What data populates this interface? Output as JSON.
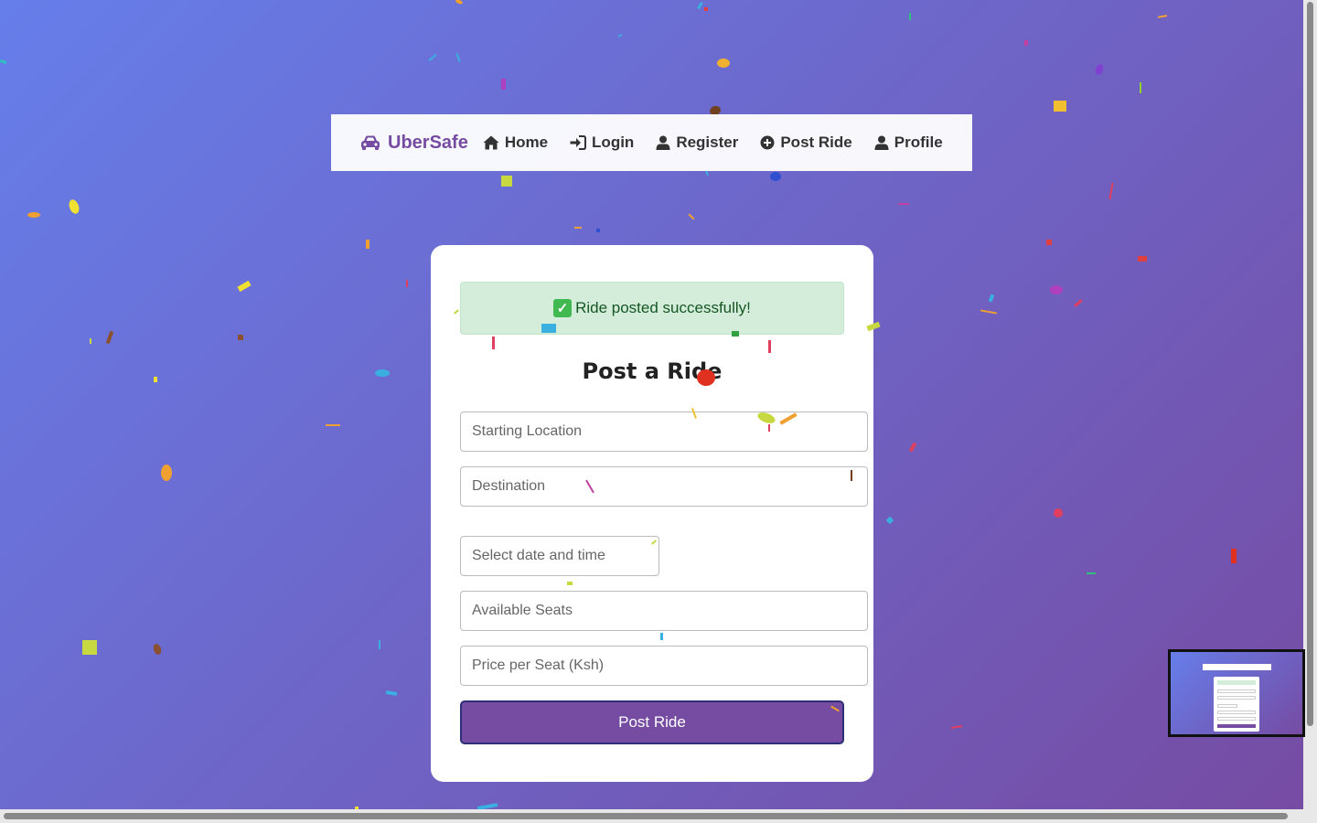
{
  "navbar": {
    "brand": "UberSafe",
    "links": [
      {
        "label": "Home"
      },
      {
        "label": "Login"
      },
      {
        "label": "Register"
      },
      {
        "label": "Post Ride"
      },
      {
        "label": "Profile"
      }
    ]
  },
  "alert": {
    "icon": "check-mark-icon",
    "message": "Ride posted successfully!",
    "color": "#155724",
    "background": "#d4edda"
  },
  "form": {
    "title": "Post a Ride",
    "start_placeholder": "Starting Location",
    "destination_placeholder": "Destination",
    "datetime_placeholder": "Select date and time",
    "seats_placeholder": "Available Seats",
    "price_placeholder": "Price per Seat (Ksh)",
    "submit_label": "Post Ride"
  },
  "colors": {
    "accent": "#764ba2",
    "gradient_start": "#667eea",
    "gradient_end": "#764ba2"
  }
}
